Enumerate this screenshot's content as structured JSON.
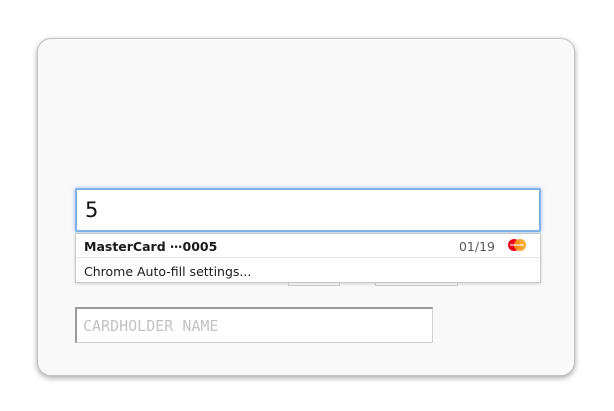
{
  "card_number_field": {
    "value": "5"
  },
  "autofill_popup": {
    "suggestion": {
      "title": "MasterCard ⋯0005",
      "expiry": "01/19",
      "icon": "mastercard-icon"
    },
    "settings_label": "Chrome Auto-fill settings..."
  },
  "cardholder_field": {
    "value": "",
    "placeholder": "CARDHOLDER NAME"
  },
  "colors": {
    "focus_border": "#7fb0e8",
    "mastercard_red": "#eb001b",
    "mastercard_orange": "#f79e1b"
  }
}
